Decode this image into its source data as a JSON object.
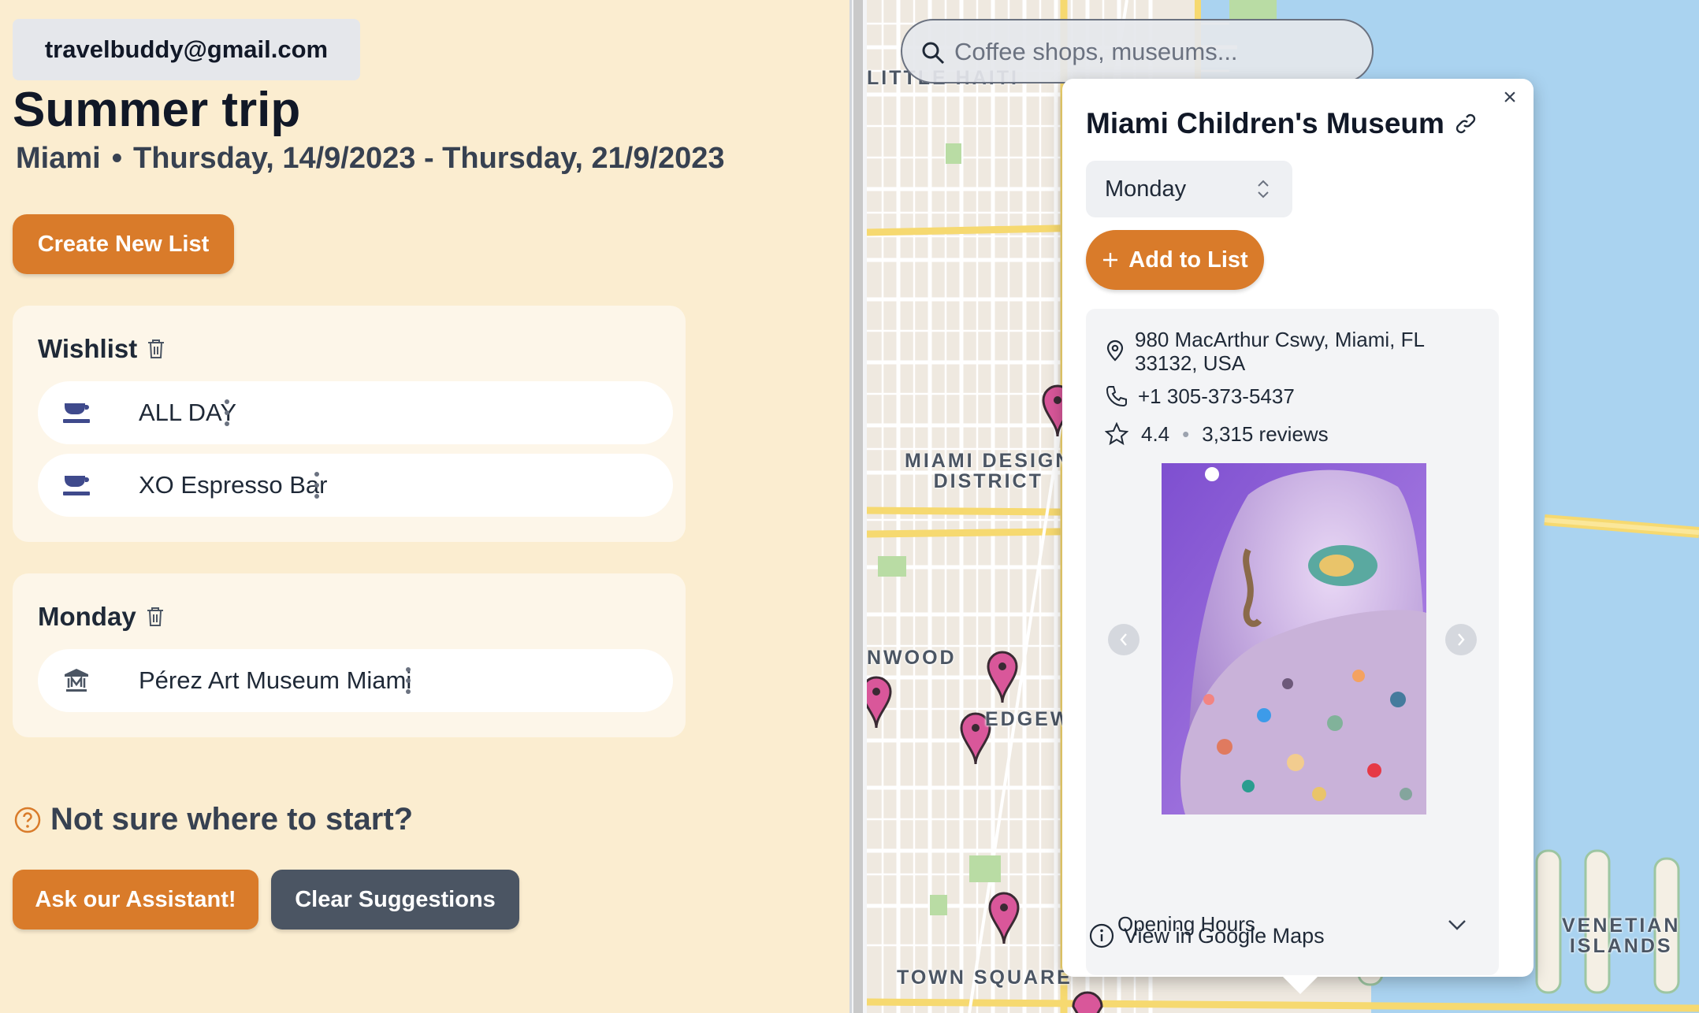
{
  "user": {
    "email": "travelbuddy@gmail.com"
  },
  "trip": {
    "title": "Summer trip",
    "city": "Miami",
    "separator": "•",
    "dates": "Thursday, 14/9/2023 - Thursday, 21/9/2023",
    "create_list_label": "Create New List"
  },
  "lists": [
    {
      "name": "Wishlist",
      "items": [
        {
          "label": "ALL DAY",
          "icon": "coffee-icon"
        },
        {
          "label": "XO Espresso Bar",
          "icon": "coffee-icon"
        }
      ]
    },
    {
      "name": "Monday",
      "items": [
        {
          "label": "Pérez Art Museum Miami",
          "icon": "museum-icon"
        }
      ]
    }
  ],
  "suggestions": {
    "prompt": "Not sure where to start?",
    "ask_label": "Ask our Assistant!",
    "clear_label": "Clear Suggestions"
  },
  "map": {
    "search_placeholder": "Coffee shops, museums...",
    "labels": {
      "little_haiti": "LITTLE HAITI",
      "design_district_1": "MIAMI DESIGN",
      "design_district_2": "DISTRICT",
      "wynwood": "NWOOD",
      "edgewater": "EDGEW",
      "town_square": "TOWN SQUARE",
      "venetian_1": "VENETIAN",
      "venetian_2": "ISLANDS"
    },
    "colors": {
      "water": "#aad3f0",
      "land": "#efe9e0",
      "road_major": "#f6d970",
      "pin": "#d9579a",
      "park": "#b9dca4"
    }
  },
  "place": {
    "name": "Miami Children's Museum",
    "selected_day": "Monday",
    "add_label": "Add to List",
    "address": "980 MacArthur Cswy, Miami, FL 33132, USA",
    "phone": "+1 305-373-5437",
    "rating": "4.4",
    "reviews": "3,315 reviews",
    "hours_label": "Opening Hours",
    "gmaps_label": "View in Google Maps"
  },
  "colors": {
    "accent": "#d97b2a",
    "background": "#fbedd0",
    "card": "#fdf6e9",
    "dark_button": "#4b5563",
    "icon_blue": "#3f4a8c"
  }
}
